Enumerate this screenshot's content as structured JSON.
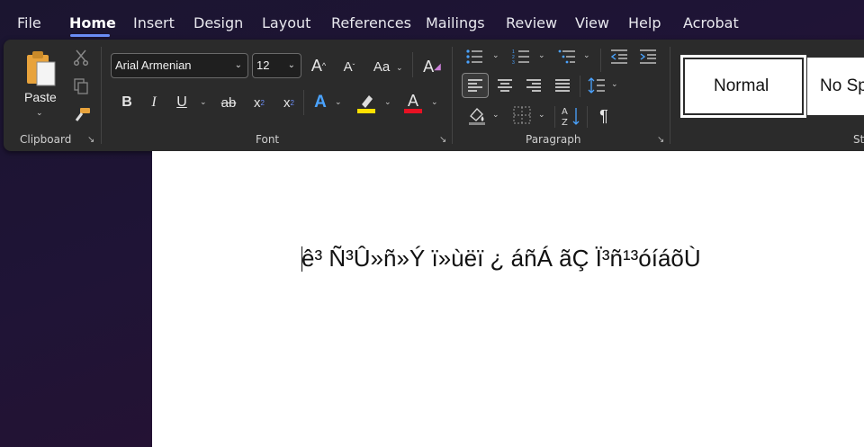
{
  "tabs": [
    "File",
    "Home",
    "Insert",
    "Design",
    "Layout",
    "References",
    "Mailings",
    "Review",
    "View",
    "Help",
    "Acrobat"
  ],
  "active_tab": "Home",
  "clipboard": {
    "paste_label": "Paste",
    "group_label": "Clipboard"
  },
  "font": {
    "name": "Arial Armenian",
    "size": "12",
    "change_case": "Aa",
    "group_label": "Font"
  },
  "paragraph": {
    "group_label": "Paragraph"
  },
  "styles": {
    "items": [
      "Normal",
      "No Sp"
    ],
    "group_label_partial": "St"
  },
  "document": {
    "text": "ê³ Ñ³Û»ñ»Ý ï»ùëï ¿ áñÁ ãÇ Ï³ñ¹³óíáõÙ"
  },
  "colors": {
    "accent": "#6b8ef7",
    "highlight": "#ffe000",
    "font_color": "#e81123",
    "text_effect": "#4aa3ff"
  }
}
